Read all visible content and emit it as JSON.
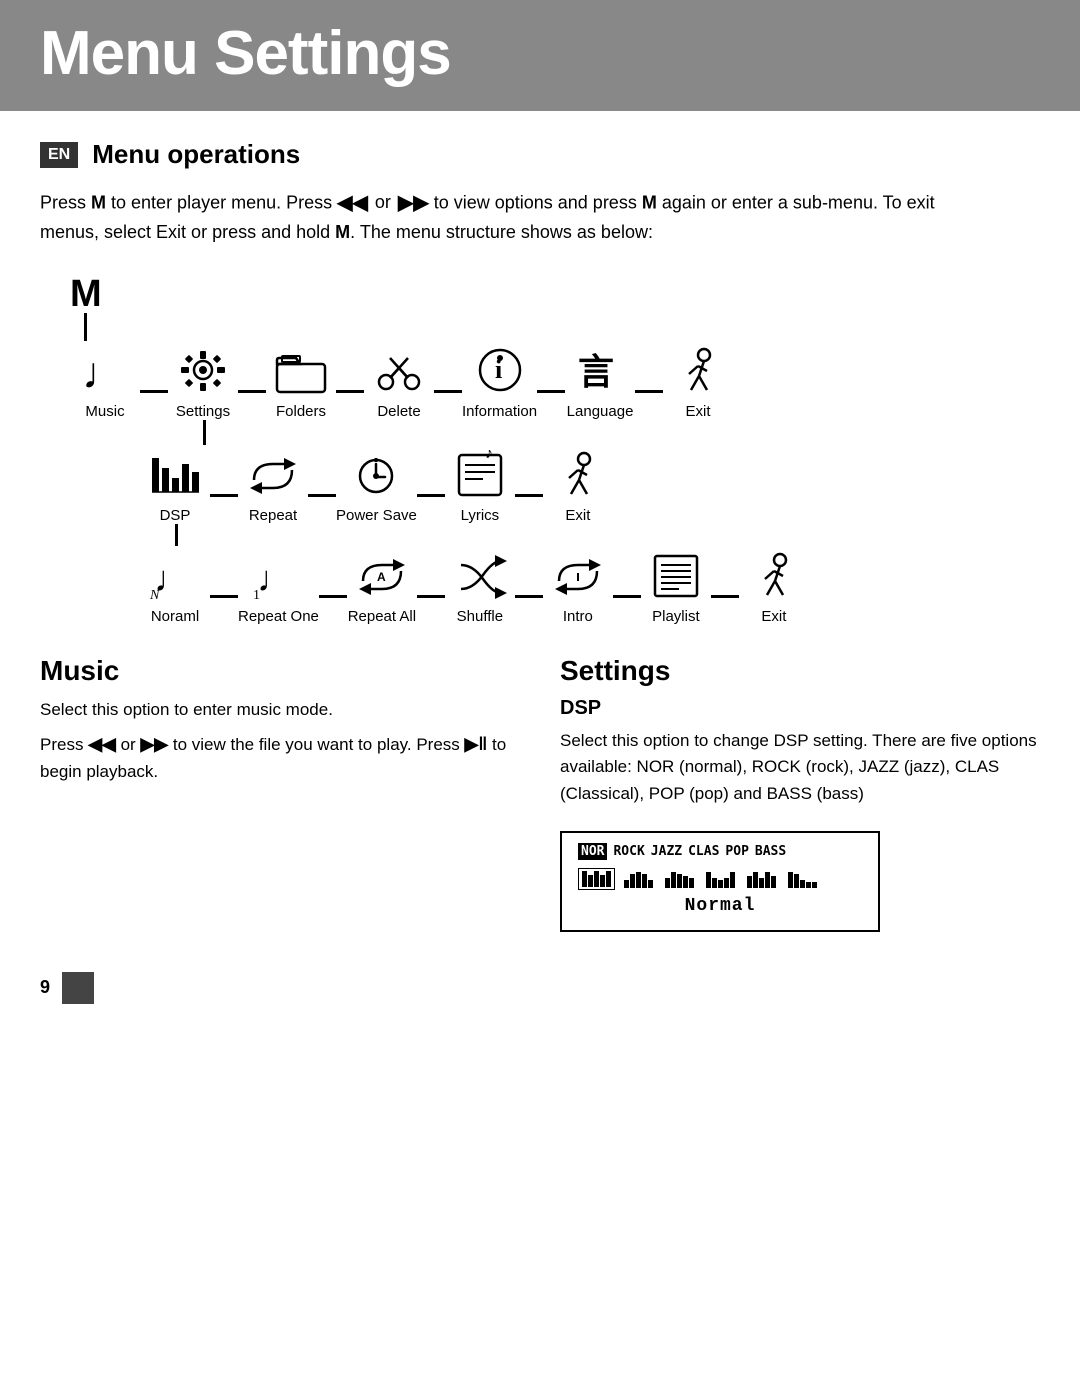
{
  "header": {
    "title": "Menu Settings"
  },
  "section1": {
    "badge": "EN",
    "title": "Menu operations",
    "intro": "Press M to enter player menu. Press",
    "intro2": "or",
    "intro3": "to view options and press",
    "intro4": "M",
    "intro5": "again or enter a sub-menu. To exit menus, select Exit or press and hold",
    "intro6": "M",
    "intro7": ". The menu structure shows as below:"
  },
  "diagram": {
    "root": "M",
    "row1_items": [
      {
        "label": "Music",
        "icon": "♩"
      },
      {
        "label": "Settings",
        "icon": "⚙"
      },
      {
        "label": "Folders",
        "icon": "📁"
      },
      {
        "label": "Delete",
        "icon": "🗑"
      },
      {
        "label": "Information",
        "icon": "ℹ"
      },
      {
        "label": "Language",
        "icon": "言"
      },
      {
        "label": "Exit",
        "icon": "🚶"
      }
    ],
    "row2_items": [
      {
        "label": "DSP",
        "icon": "🎚"
      },
      {
        "label": "Repeat",
        "icon": "🔁"
      },
      {
        "label": "Power Save",
        "icon": "💡"
      },
      {
        "label": "Lyrics",
        "icon": "📝"
      },
      {
        "label": "Exit",
        "icon": "🚶"
      }
    ],
    "row3_items": [
      {
        "label": "Noraml",
        "icon": "♩"
      },
      {
        "label": "Repeat One",
        "icon": "🔂"
      },
      {
        "label": "Repeat All",
        "icon": "🔁"
      },
      {
        "label": "Shuffle",
        "icon": "🔀"
      },
      {
        "label": "Intro",
        "icon": "⏮"
      },
      {
        "label": "Playlist",
        "icon": "📋"
      },
      {
        "label": "Exit",
        "icon": "🚶"
      }
    ]
  },
  "music_section": {
    "title": "Music",
    "text1": "Select this option to enter music mode.",
    "text2": "Press",
    "text3": "or",
    "text4": "to view the file you want to play. Press",
    "text5": "to begin playback."
  },
  "settings_section": {
    "title": "Settings",
    "dsp_title": "DSP",
    "dsp_text": "Select this option to change DSP setting. There are five options available: NOR (normal), ROCK (rock), JAZZ (jazz), CLAS (Classical), POP (pop) and BASS (bass)",
    "dsp_options": [
      "NOR",
      "ROCK",
      "JAZZ",
      "CLAS",
      "POP",
      "BASS"
    ],
    "dsp_normal_label": "Normal"
  },
  "footer": {
    "page_number": "9"
  }
}
